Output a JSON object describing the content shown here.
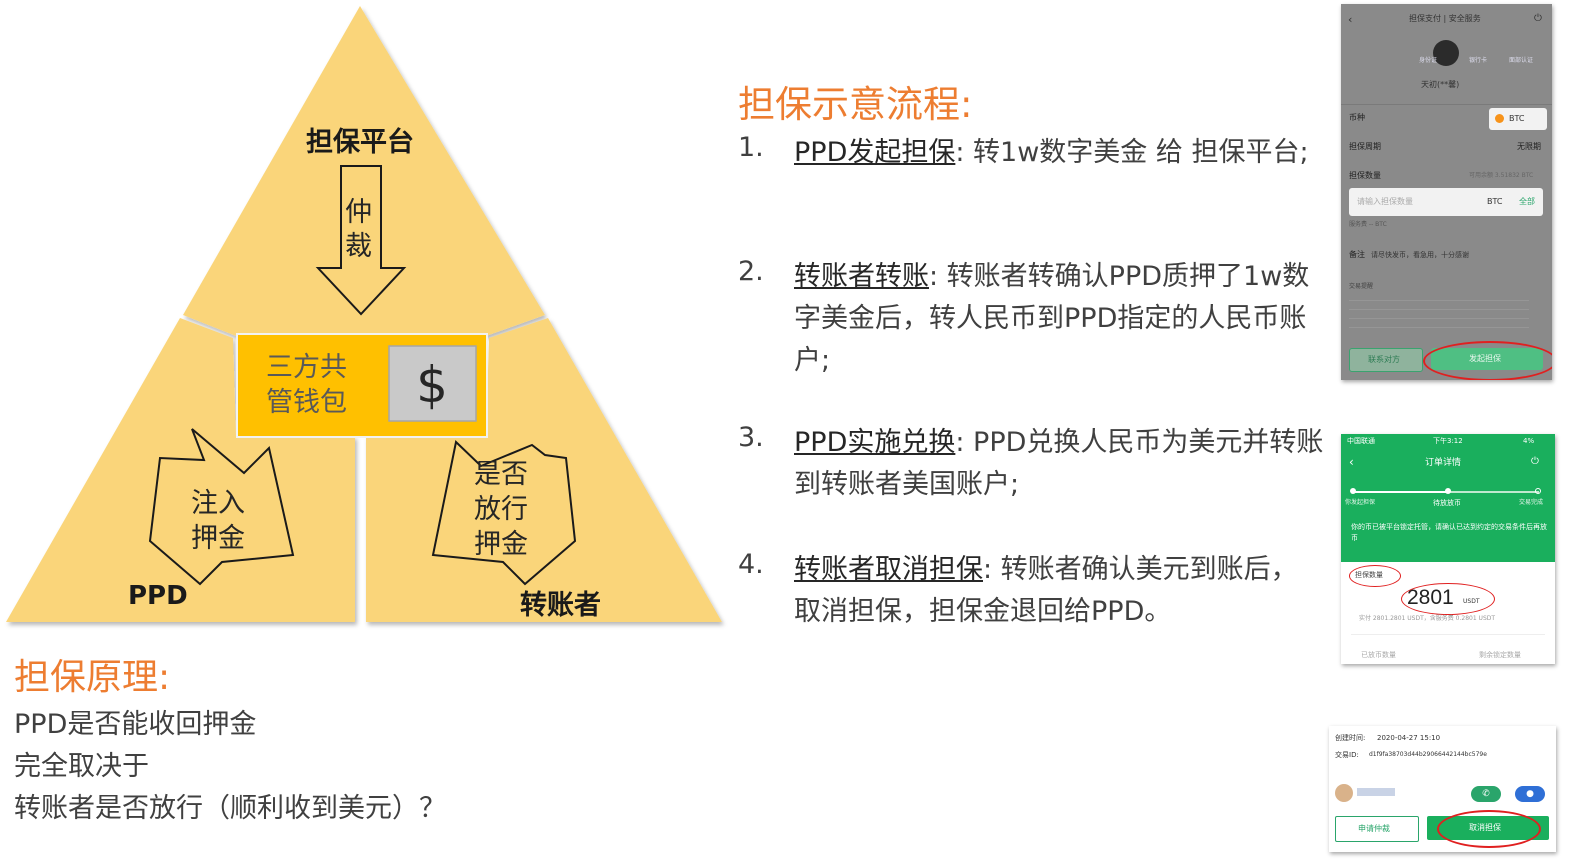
{
  "diagram": {
    "top_label": "担保平台",
    "arrow_down_label": "仲裁",
    "wallet_label": "三方共管钱包",
    "wallet_icon": "dollar-sign-icon",
    "left_arrow_label": "注入押金",
    "right_arrow_label": "是否放行押金",
    "left_label": "PPD",
    "right_label": "转账者",
    "colors": {
      "triangle": "#FAD57A",
      "wallet": "#FFC000",
      "wallet_box": "#C9C9C9"
    }
  },
  "flow": {
    "title": "担保示意流程:",
    "steps": [
      {
        "num": "1.",
        "head": "PPD发起担保",
        "body": ": 转1w数字美金 给 担保平台;"
      },
      {
        "num": "2.",
        "head": "转账者转账",
        "body": ": 转账者转确认PPD质押了1w数字美金后，转人民币到PPD指定的人民币账户;"
      },
      {
        "num": "3.",
        "head": "PPD实施兑换",
        "body": ": PPD兑换人民币为美元并转账到转账者美国账户;"
      },
      {
        "num": "4.",
        "head": "转账者取消担保",
        "body": ": 转账者确认美元到账后，取消担保，担保金退回给PPD。"
      }
    ]
  },
  "principle": {
    "title": "担保原理:",
    "lines": [
      "PPD是否能收回押金",
      "完全取决于",
      "转账者是否放行（顺利收到美元）？"
    ]
  },
  "screenshot1": {
    "header": "担保支付 | 安全服务",
    "badges": [
      "身份证",
      "银行卡",
      "面部认证"
    ],
    "user": "天初(**馨)",
    "rows": {
      "currency_label": "币种",
      "currency_value": "BTC",
      "period_label": "担保周期",
      "period_value": "无限期",
      "amount_label": "担保数量",
      "balance_hint": "可用余额 3.51832 BTC",
      "input_placeholder": "请输入担保数量",
      "input_unit": "BTC",
      "input_all": "全部",
      "fee_hint": "服务费 -- BTC",
      "note_label": "备注",
      "note_value": "请尽快发币，看急用，十分感谢"
    },
    "tips_title": "交易提醒",
    "btn_contact": "联系对方",
    "btn_start": "发起担保"
  },
  "screenshot2": {
    "status_carrier": "中国联通",
    "status_time": "下午3:12",
    "status_battery": "4%",
    "title": "订单详情",
    "progress": [
      "你发起担保",
      "待放放币",
      "交易完成"
    ],
    "notice": "你的币已被平台锁定托管，请确认已达到约定的交易条件后再放币",
    "amount_label": "担保数量",
    "amount": "2801",
    "unit": "USDT",
    "sub": "实付 2801.2801 USDT，含服务费 0.2801 USDT",
    "bottom_left": "已放币数量",
    "bottom_right": "剩余锁定数量"
  },
  "screenshot3": {
    "created_label": "创建时间:",
    "created_value": "2020-04-27 15:10",
    "tx_label": "交易ID:",
    "tx_value": "d1f9fa38703d44b29066442144bc579e",
    "btn_left": "申请仲裁",
    "btn_right": "取消担保"
  }
}
